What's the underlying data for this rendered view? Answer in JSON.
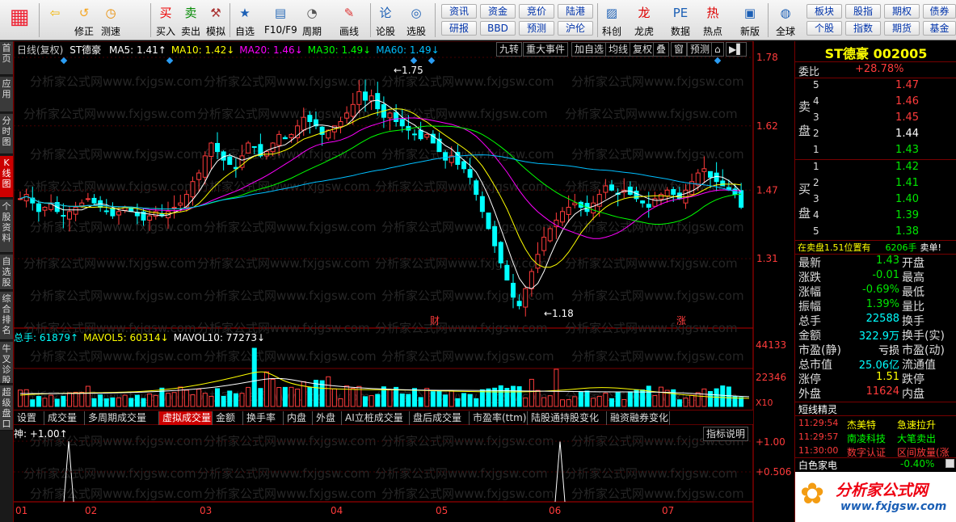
{
  "toolbar": {
    "big_buttons": [
      {
        "label": "",
        "icon": "grid-icon",
        "color": "#e23"
      },
      {
        "label": "",
        "icon": "back-arrow-icon",
        "color": "#f2b400"
      },
      {
        "label": "修正",
        "icon": "modify-icon",
        "color": "#f5a623"
      },
      {
        "label": "测速",
        "icon": "clock-icon",
        "color": "#e98c00"
      },
      {
        "label": "买入",
        "icon": "buy-icon",
        "color": "#e00"
      },
      {
        "label": "卖出",
        "icon": "sell-icon",
        "color": "#080"
      },
      {
        "label": "模拟",
        "icon": "hammer-icon",
        "color": "#a33"
      },
      {
        "label": "自选",
        "icon": "star-icon",
        "color": "#1b5fb5"
      },
      {
        "label": "F10/F9",
        "icon": "f10-icon",
        "color": "#2b6cb8"
      },
      {
        "label": "周期",
        "icon": "cycle-icon",
        "color": "#555"
      },
      {
        "label": "画线",
        "icon": "pen-icon",
        "color": "#d33"
      },
      {
        "label": "论股",
        "icon": "forum-icon",
        "color": "#1b5fb5"
      },
      {
        "label": "选股",
        "icon": "select-stock-icon",
        "color": "#1b5fb5"
      },
      {
        "label": "科创",
        "icon": "chart-icon",
        "color": "#1b5fb5"
      },
      {
        "label": "龙虎",
        "icon": "dragon-icon",
        "color": "#d00"
      },
      {
        "label": "数据",
        "icon": "pe-icon",
        "color": "#1b5fb5"
      },
      {
        "label": "热点",
        "icon": "hot-icon",
        "color": "#d00"
      },
      {
        "label": "新版",
        "icon": "new-version-icon",
        "color": "#1b5fb5"
      },
      {
        "label": "全球",
        "icon": "globe-icon",
        "color": "#1b5fb5"
      }
    ],
    "small_buttons": [
      [
        "资讯",
        "研报"
      ],
      [
        "资金",
        "BBD"
      ],
      [
        "竞价",
        "预测"
      ],
      [
        "陆港",
        "沪伦"
      ],
      [
        "板块",
        "个股"
      ],
      [
        "股指",
        "指数"
      ],
      [
        "期权",
        "期货"
      ],
      [
        "债券",
        "基金"
      ]
    ]
  },
  "left_tabs": [
    "首页",
    "应用",
    "分时图",
    "K线图",
    "个股资料",
    "自选股",
    "综合排名",
    "牛叉诊股",
    "超级盘口"
  ],
  "chart": {
    "period_label": "日线(复权)",
    "stock_name": "ST德豪",
    "ma": [
      {
        "label": "MA5: 1.41↑",
        "color": "#ffffff"
      },
      {
        "label": "MA10: 1.42↓",
        "color": "#ffff00"
      },
      {
        "label": "MA20: 1.46↓",
        "color": "#ff00ff"
      },
      {
        "label": "MA30: 1.49↓",
        "color": "#00ff00"
      },
      {
        "label": "MA60: 1.49↓",
        "color": "#00bfff"
      }
    ],
    "top_buttons": [
      "九转",
      "重大事件",
      "加自选",
      "均线",
      "复权",
      "叠",
      "窗",
      "预测"
    ],
    "price_ticks": [
      "1.78",
      "1.62",
      "1.47",
      "1.31"
    ],
    "high_label": "1.75",
    "low_label": "1.18",
    "markers": [
      "财",
      "涨"
    ],
    "volume_legend": [
      {
        "label": "总手: 61879↑",
        "color": "#00ffff"
      },
      {
        "label": "MAVOL5: 60314↓",
        "color": "#ffff00"
      },
      {
        "label": "MAVOL10: 77273↓",
        "color": "#ffffff"
      }
    ],
    "volume_ticks": [
      "44133",
      "22346"
    ],
    "volume_unit": "X10",
    "bottom_tabs": [
      "设置",
      "成交量",
      "多周期成交量",
      "虚拟成交量",
      "金额",
      "换手率",
      "内盘",
      "外盘",
      "AI立桩成交量",
      "盘后成交量",
      "市盈率(ttm)",
      "陆股通持股变化",
      "融资融券变化"
    ],
    "active_tab": "虚拟成交量",
    "indicator_legend": "神: +1.00↑",
    "indicator_button": "指标说明",
    "indicator_ticks": [
      "+1.00",
      "+0.506"
    ],
    "months": [
      "01",
      "02",
      "03",
      "04",
      "05",
      "06",
      "07"
    ],
    "watermark": "分析家公式网www.fxjgsw.com"
  },
  "quote": {
    "name": "ST德豪 002005",
    "weibi_label": "委比",
    "weibi_value": "+28.78%",
    "sell_label": "卖盘",
    "buy_label": "买盘",
    "sell": [
      {
        "n": "5",
        "p": "1.47"
      },
      {
        "n": "4",
        "p": "1.46"
      },
      {
        "n": "3",
        "p": "1.45"
      },
      {
        "n": "2",
        "p": "1.44"
      },
      {
        "n": "1",
        "p": "1.43"
      }
    ],
    "buy": [
      {
        "n": "1",
        "p": "1.42"
      },
      {
        "n": "2",
        "p": "1.41"
      },
      {
        "n": "3",
        "p": "1.40"
      },
      {
        "n": "4",
        "p": "1.39"
      },
      {
        "n": "5",
        "p": "1.38"
      }
    ],
    "position_text": "在卖盘1.51位置有",
    "position_vol": "6206手",
    "position_action": "卖单!",
    "stats": [
      {
        "l": "最新",
        "v": "1.43",
        "c": "green",
        "r": "开盘"
      },
      {
        "l": "涨跌",
        "v": "-0.01",
        "c": "green",
        "r": "最高"
      },
      {
        "l": "涨幅",
        "v": "-0.69%",
        "c": "green",
        "r": "最低"
      },
      {
        "l": "振幅",
        "v": "1.39%",
        "c": "green",
        "r": "量比"
      },
      {
        "l": "总手",
        "v": "22588",
        "c": "cyan",
        "r": "换手"
      },
      {
        "l": "金额",
        "v": "322.9万",
        "c": "cyan",
        "r": "换手(实)"
      },
      {
        "l": "市盈(静)",
        "v": "亏损",
        "c": "white",
        "r": "市盈(动)"
      },
      {
        "l": "总市值",
        "v": "25.06亿",
        "c": "cyan",
        "r": "流通值"
      },
      {
        "l": "涨停",
        "v": "1.51",
        "c": "yel",
        "r": "跌停"
      },
      {
        "l": "外盘",
        "v": "11624",
        "c": "red",
        "r": "内盘"
      }
    ],
    "wizard_title": "短线精灵",
    "wizard": [
      {
        "t": "11:29:54",
        "s": "杰美特",
        "e": "急速拉升",
        "c": "#ffff00"
      },
      {
        "t": "11:29:57",
        "s": "南凌科技",
        "e": "大笔卖出",
        "c": "#00ff00"
      },
      {
        "t": "11:30:00",
        "s": "数字认证",
        "e": "区间放量(涨",
        "c": "#ff3b3b"
      }
    ],
    "sector_name": "白色家电",
    "sector_change": "-0.40%",
    "logo_text": "分析家公式网",
    "logo_url": "www.fxjgsw.com"
  }
}
